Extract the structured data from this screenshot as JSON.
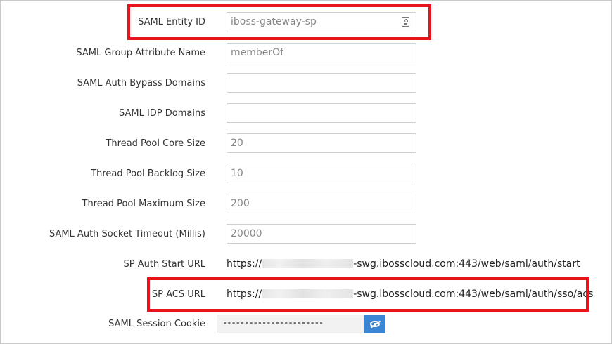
{
  "fields": [
    {
      "label": "SAML Entity ID",
      "value": "iboss-gateway-sp",
      "icon": "id-card-icon"
    },
    {
      "label": "SAML Group Attribute Name",
      "value": "memberOf"
    },
    {
      "label": "SAML Auth Bypass Domains",
      "value": ""
    },
    {
      "label": "SAML IDP Domains",
      "value": ""
    },
    {
      "label": "Thread Pool Core Size",
      "value": "20"
    },
    {
      "label": "Thread Pool Backlog Size",
      "value": "10"
    },
    {
      "label": "Thread Pool Maximum Size",
      "value": "200"
    },
    {
      "label": "SAML Auth Socket Timeout (Millis)",
      "value": "20000"
    }
  ],
  "sp_auth_start": {
    "label": "SP Auth Start URL",
    "prefix": "https://",
    "suffix": "-swg.ibosscloud.com:443/web/saml/auth/start"
  },
  "sp_acs": {
    "label": "SP ACS URL",
    "prefix": "https://",
    "suffix": "-swg.ibosscloud.com:443/web/saml/auth/sso/acs"
  },
  "session_cookie": {
    "label": "SAML Session Cookie",
    "masked_value": "•••••••••••••••••••••••",
    "reveal_icon": "eye-slash-icon"
  },
  "colors": {
    "highlight": "#e8141b",
    "button": "#3b86d4"
  }
}
